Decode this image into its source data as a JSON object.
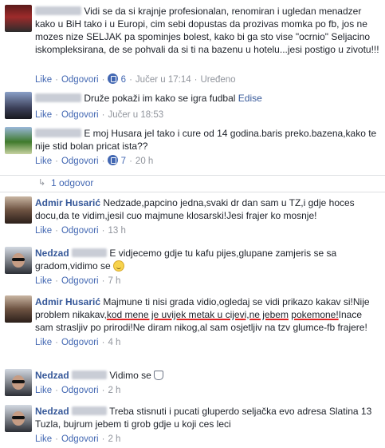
{
  "actions": {
    "like": "Like",
    "reply": "Odgovori",
    "sep": "·"
  },
  "comments": [
    {
      "name": "",
      "text": "Vidi se da si krajnje profesionalan, renomiran i ugledan menadzer kako u BiH tako i u Europi, cim sebi dopustas da prozivas momka po fb, jos ne mozes nize SELJAK pa spominjes bolest, kako bi ga sto vise \"ocrnio\" Seljacino iskompleksirana, de se pohvali da si ti na bazenu u hotelu...jesi postigo u zivotu!!!",
      "likes": "6",
      "time": "Jučer u 17:14",
      "edited": "Uređeno"
    },
    {
      "name": "",
      "text": "Druže pokaži im kako se igra fudbal",
      "mention": "Edise",
      "time": "Jučer u 18:53"
    },
    {
      "name": "",
      "text": "E moj Husara jel tako i cure od 14 godina.baris preko.bazena,kako te nije stid bolan pricat ista??",
      "likes": "7",
      "time": "20 h"
    }
  ],
  "replies_label": "1 odgovor",
  "replies": [
    {
      "name": "Admir Husarić",
      "text": "Nedzade,papcino jedna,svaki dr dan sam u TZ,i gdje hoces docu,da te vidim,jesil cuo majmune klosarski!Jesi frajer ko mosnje!",
      "time": "13 h"
    },
    {
      "name": "Nedzad",
      "text": "E vidjecemo gdje tu kafu pijes,glupane zamjeris se sa gradom,vidimo se",
      "time": "7 h"
    },
    {
      "name": "Admir Husarić",
      "text_a": "Majmune ti nisi grada vidio,ogledaj se vidi prikazo kakav si!Nije problem nikakav,",
      "text_u1": "kod mene je uvijek metak u cijevi,ne jebem",
      "text_u2": "pokemone!",
      "text_b": "Inace sam strasljiv po prirodi!Ne diram nikog,al sam osjetljiv na tzv glumce-fb frajere!",
      "time": "4 h"
    },
    {
      "name": "Nedzad",
      "text": "Vidimo se",
      "time": "2 h"
    },
    {
      "name": "Nedzad",
      "text": "Treba stisnuti i pucati gluperdo seljačka evo adresa Slatina 13 Tuzla, bujrum jebem ti grob gdje u koji ces leci",
      "time": "2 h"
    }
  ]
}
